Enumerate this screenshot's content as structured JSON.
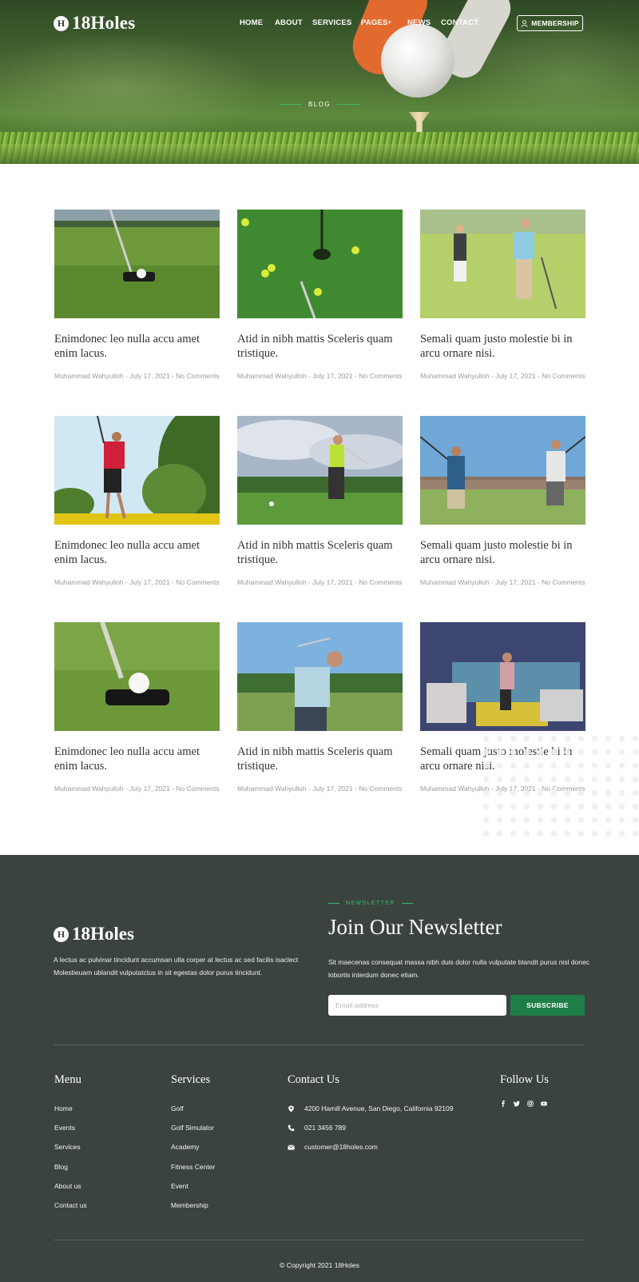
{
  "header": {
    "logo_letter": "H",
    "logo_text": "18Holes",
    "nav": [
      "HOME",
      "ABOUT",
      "SERVICES",
      "PAGES",
      "NEWS",
      "CONTACT"
    ],
    "membership_label": "MEMBERSHIP",
    "page_title": "BLOG"
  },
  "posts": [
    {
      "title": "Enimdonec leo nulla accu amet enim lacus.",
      "meta": "Muhammad Wahyulloh - July 17, 2021 - No Comments"
    },
    {
      "title": "Atid in nibh mattis Sceleris quam tristique.",
      "meta": "Muhammad Wahyulloh - July 17, 2021 - No Comments"
    },
    {
      "title": "Semali quam justo molestie bi in arcu ornare nisi.",
      "meta": "Muhammad Wahyulloh - July 17, 2021 - No Comments"
    },
    {
      "title": "Enimdonec leo nulla accu amet enim lacus.",
      "meta": "Muhammad Wahyulloh - July 17, 2021 - No Comments"
    },
    {
      "title": "Atid in nibh mattis Sceleris quam tristique.",
      "meta": "Muhammad Wahyulloh - July 17, 2021 - No Comments"
    },
    {
      "title": "Semali quam justo molestie bi in arcu ornare nisi.",
      "meta": "Muhammad Wahyulloh - July 17, 2021 - No Comments"
    },
    {
      "title": "Enimdonec leo nulla accu amet enim lacus.",
      "meta": "Muhammad Wahyulloh - July 17, 2021 - No Comments"
    },
    {
      "title": "Atid in nibh mattis Sceleris quam tristique.",
      "meta": "Muhammad Wahyulloh - July 17, 2021 - No Comments"
    },
    {
      "title": "Semali quam justo molestie bi in arcu ornare nisi.",
      "meta": "Muhammad Wahyulloh - July 17, 2021 - No Comments"
    }
  ],
  "footer": {
    "logo_letter": "H",
    "logo_text": "18Holes",
    "description": "A lectus ac pulvinar tincidunt accumsan ulla corper at lectus ac sed facilis isaclect Molestieuam ublandit vulputatctus in sit egestas dolor purus tincidunt.",
    "newsletter": {
      "kicker": "NEWSLETTER",
      "title": "Join Our Newsletter",
      "description": "Sit maecenas consequat massa nibh duis dolor nulla vulputate blandit purus nisl donec lobortis interdum donec etiam.",
      "placeholder": "Email address",
      "button": "SUBSCRIBE"
    },
    "menu": {
      "title": "Menu",
      "items": [
        "Home",
        "Events",
        "Services",
        "Blog",
        "About us",
        "Contact us"
      ]
    },
    "services": {
      "title": "Services",
      "items": [
        "Golf",
        "Golf Simulator",
        "Academy",
        "Fitness Center",
        "Event",
        "Membership"
      ]
    },
    "contact": {
      "title": "Contact Us",
      "address": "4200 Hamill Avenue, San Diego, California 92109",
      "phone": "021 3456 789",
      "email": "customer@18holes.com"
    },
    "follow": {
      "title": "Follow Us",
      "icons": [
        "facebook-icon",
        "twitter-icon",
        "instagram-icon",
        "youtube-icon"
      ]
    },
    "copyright": "© Copyright 2021 18Holes"
  },
  "colors": {
    "accent_green": "#1f7e47",
    "kicker_green": "#3bbb66",
    "footer_bg": "#3b433f"
  }
}
